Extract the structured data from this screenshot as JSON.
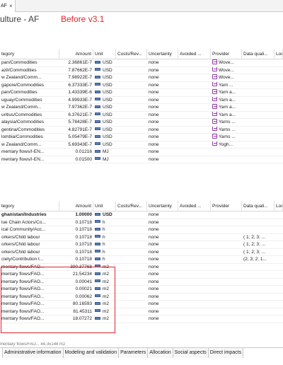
{
  "editor_tab": {
    "label": "AF",
    "close_glyph": "×"
  },
  "header": {
    "process_title": "ulture - AF",
    "overlay_label": "Before v3.1"
  },
  "inputs_table": {
    "columns": [
      "tegory",
      "Amount",
      "Unit",
      "Costs/Rev...",
      "Uncertainty",
      "Avoided ...",
      "Provider",
      "Data quali...",
      "Loc"
    ],
    "rows": [
      {
        "category": "pan/Commodities",
        "amount": "2.36861E-7",
        "unit": "USD",
        "uncertainty": "none",
        "provider": "Wove..."
      },
      {
        "category": "azil/Commodities",
        "amount": "7.87662E-7",
        "unit": "USD",
        "uncertainty": "none",
        "provider": "Wove..."
      },
      {
        "category": "w Zealand/Comm...",
        "amount": "7.98922E-7",
        "unit": "USD",
        "uncertainty": "none",
        "provider": "Wove..."
      },
      {
        "category": "gapore/Commodities",
        "amount": "6.37333E-7",
        "unit": "USD",
        "uncertainty": "none",
        "provider": "Yarn ..."
      },
      {
        "category": "pan/Commodities",
        "amount": "1.43339E-6",
        "unit": "USD",
        "uncertainty": "none",
        "provider": "Yarn a..."
      },
      {
        "category": "uguay/Commodities",
        "amount": "4.99933E-7",
        "unit": "USD",
        "uncertainty": "none",
        "provider": "Yarn a..."
      },
      {
        "category": "w Zealand/Comm...",
        "amount": "7.97362E-7",
        "unit": "USD",
        "uncertainty": "none",
        "provider": "Yarn a..."
      },
      {
        "category": "uritius/Commodities",
        "amount": "6.37621E-7",
        "unit": "USD",
        "uncertainty": "none",
        "provider": "Yarn a..."
      },
      {
        "category": "alaysia/Commodities",
        "amount": "5.78428E-7",
        "unit": "USD",
        "uncertainty": "none",
        "provider": "Yarns ..."
      },
      {
        "category": "gentina/Commodities",
        "amount": "4.82791E-7",
        "unit": "USD",
        "uncertainty": "none",
        "provider": "Yarns ..."
      },
      {
        "category": "lombia/Commodities",
        "amount": "5.05479E-7",
        "unit": "USD",
        "uncertainty": "none",
        "provider": "Yarns ..."
      },
      {
        "category": "w Zealand/Comm...",
        "amount": "5.69343E-7",
        "unit": "USD",
        "uncertainty": "none",
        "provider": "Yogh..."
      },
      {
        "category": "mentary flows/I-EN...",
        "amount": "0.01216",
        "unit": "MJ",
        "uncertainty": "none",
        "provider": ""
      },
      {
        "category": "mentary flows/I-EN...",
        "amount": "0.01500",
        "unit": "MJ",
        "uncertainty": "none",
        "provider": ""
      }
    ]
  },
  "outputs_table": {
    "columns": [
      "tegory",
      "Amount",
      "Unit",
      "Costs/Rev...",
      "Uncertainty",
      "Avoided ...",
      "Provider",
      "Data quali...",
      "Loc"
    ],
    "rows": [
      {
        "category": "ghanistan/Industries",
        "amount": "1.00000",
        "unit": "USD",
        "uncertainty": "none",
        "dq": "",
        "bold": true
      },
      {
        "category": "lue Chain Actors/Co...",
        "amount": "0.10718",
        "unit": "h",
        "uncertainty": "none",
        "dq": ""
      },
      {
        "category": "ical Community/Acc...",
        "amount": "0.10718",
        "unit": "h",
        "uncertainty": "none",
        "dq": ""
      },
      {
        "category": "orkers/Child labour",
        "amount": "0.10718",
        "unit": "h",
        "uncertainty": "none",
        "dq": "( 1; 2; 3; ..."
      },
      {
        "category": "orkers/Child labour",
        "amount": "0.10718",
        "unit": "h",
        "uncertainty": "none",
        "dq": "( 1; 2; 3; ..."
      },
      {
        "category": "orkers/Child labour",
        "amount": "0.10718",
        "unit": "h",
        "uncertainty": "none",
        "dq": "( 1; 2; 3; ..."
      },
      {
        "category": "ciety/Contribution t...",
        "amount": "0.10718",
        "unit": "h",
        "uncertainty": "none",
        "dq": "(2; 3; 2; 1..."
      },
      {
        "category": "mentary flows/FAO...",
        "amount": "390.37768",
        "unit": "m2",
        "uncertainty": "none",
        "dq": ""
      },
      {
        "category": "mentary flows/FAO...",
        "amount": "21.54234",
        "unit": "m2",
        "uncertainty": "none",
        "dq": ""
      },
      {
        "category": "mentary flows/FAO...",
        "amount": "0.00041",
        "unit": "m2",
        "uncertainty": "none",
        "dq": ""
      },
      {
        "category": "mentary flows/FAO...",
        "amount": "0.00021",
        "unit": "m2",
        "uncertainty": "none",
        "dq": ""
      },
      {
        "category": "mentary flows/FAO...",
        "amount": "0.00062",
        "unit": "m2",
        "uncertainty": "none",
        "dq": ""
      },
      {
        "category": "mentary flows/FAO...",
        "amount": "80.16593",
        "unit": "m2",
        "uncertainty": "none",
        "dq": ""
      },
      {
        "category": "mentary flows/FAO...",
        "amount": "81.45311",
        "unit": "m2",
        "uncertainty": "none",
        "dq": ""
      },
      {
        "category": "mentary flows/FAO...",
        "amount": "18.07272",
        "unit": "m2",
        "uncertainty": "none",
        "dq": ""
      }
    ],
    "partial_next_row": "mentary flows/FAO...   44.35148   m2"
  },
  "bottom_tabs": [
    "Administrative information",
    "Modeling and validation",
    "Parameters",
    "Allocation",
    "Social aspects",
    "Direct impacts"
  ]
}
